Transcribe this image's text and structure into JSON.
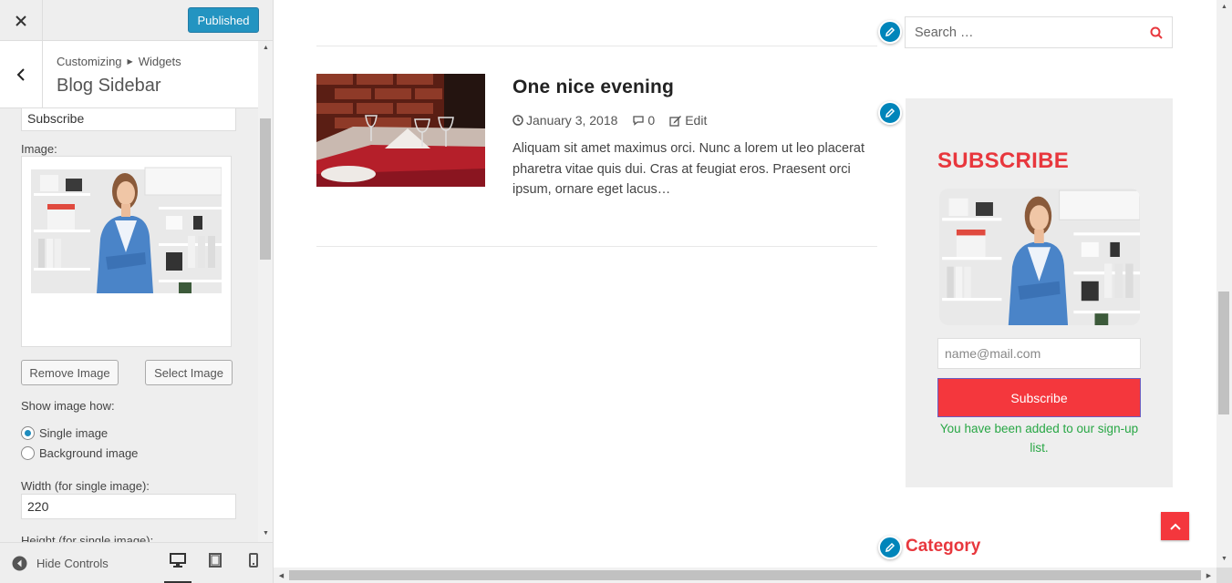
{
  "topbar": {
    "publish_label": "Published",
    "close_icon": "close-icon"
  },
  "section": {
    "breadcrumb_parent": "Customizing",
    "breadcrumb_child": "Widgets",
    "title": "Blog Sidebar"
  },
  "form": {
    "title_value": "Subscribe",
    "image_label": "Image:",
    "remove_image_label": "Remove Image",
    "select_image_label": "Select Image",
    "show_image_label": "Show image how:",
    "radio_single": "Single image",
    "radio_background": "Background image",
    "width_label": "Width (for single image):",
    "width_value": "220",
    "height_label": "Height (for single image):"
  },
  "footer": {
    "hide_controls_label": "Hide Controls"
  },
  "post": {
    "title": "One nice evening",
    "date": "January 3, 2018",
    "comments": "0",
    "edit_label": "Edit",
    "excerpt": "Aliquam sit amet maximus orci. Nunc a lorem ut leo placerat pharetra vitae quis dui. Cras at feugiat eros. Praesent orci ipsum, ornare eget lacus…"
  },
  "sidebar": {
    "search_placeholder": "Search …",
    "subscribe_title": "SUBSCRIBE",
    "email_placeholder": "name@mail.com",
    "subscribe_button": "Subscribe",
    "success_message": "You have been added to our sign-up list.",
    "category_title": "Category"
  },
  "colors": {
    "accent_blue": "#0085ba",
    "brand_red": "#e8373d",
    "success_green": "#28a745"
  }
}
